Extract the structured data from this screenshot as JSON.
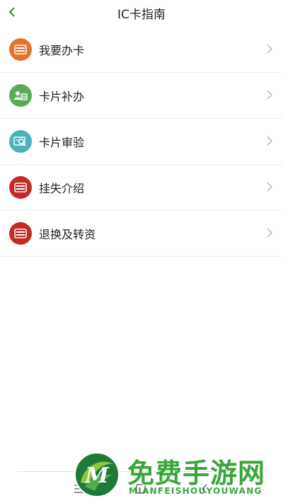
{
  "header": {
    "title": "IC卡指南"
  },
  "items": [
    {
      "label": "我要办卡",
      "icon": "card-icon",
      "color": "#e2742c"
    },
    {
      "label": "卡片补办",
      "icon": "id-card-icon",
      "color": "#5aaa56"
    },
    {
      "label": "卡片审验",
      "icon": "card-search-icon",
      "color": "#4cb2b5"
    },
    {
      "label": "挂失介绍",
      "icon": "card-icon",
      "color": "#c42a25"
    },
    {
      "label": "退换及转资",
      "icon": "card-icon",
      "color": "#c42a25"
    }
  ],
  "watermark": {
    "main": "免费手游网",
    "sub": "MIANFEISHOUYOUWANG"
  },
  "colors": {
    "accent": "#2a8a3a",
    "chevron": "#b5b5b5",
    "divider": "#ececec"
  }
}
